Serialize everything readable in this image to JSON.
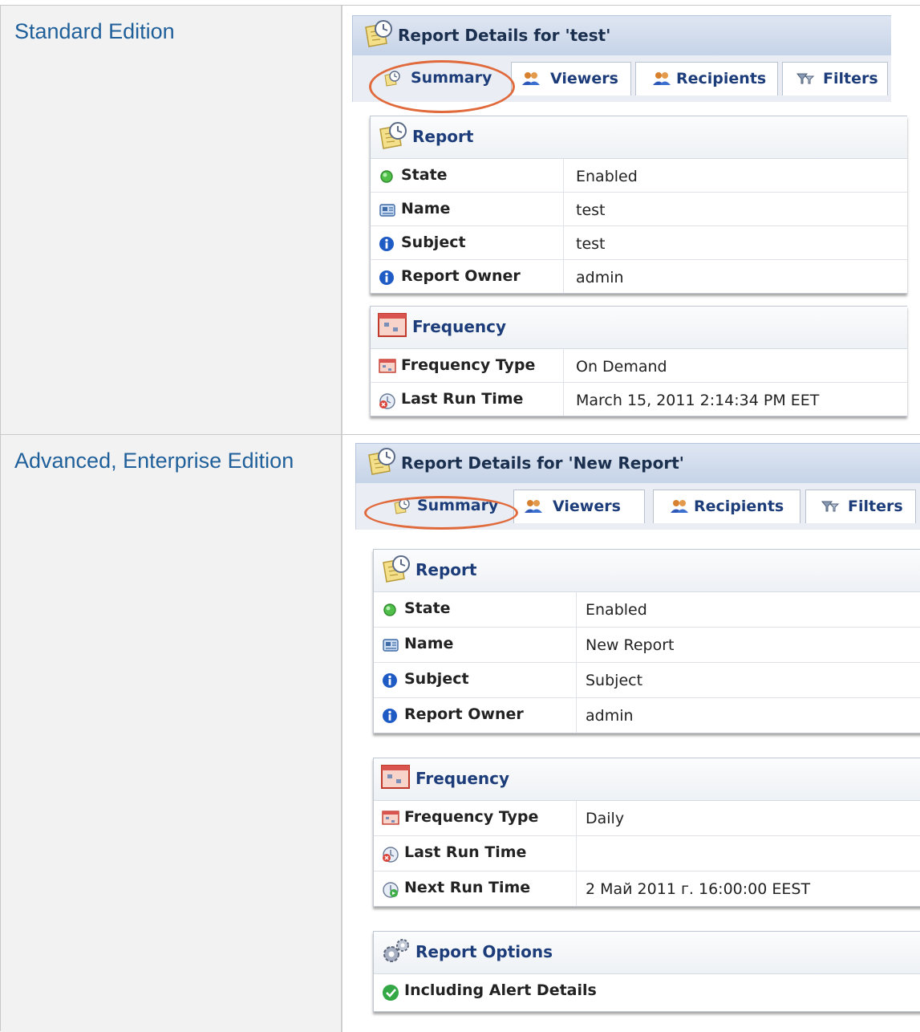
{
  "rows": [
    {
      "edition": "Standard Edition",
      "window_title": "Report Details for 'test'",
      "tabs": [
        "Summary",
        "Viewers",
        "Recipients",
        "Filters"
      ],
      "report_section": {
        "heading": "Report",
        "fields": [
          {
            "label": "State",
            "value": "Enabled",
            "icon": "green-dot-icon"
          },
          {
            "label": "Name",
            "value": "test",
            "icon": "name-card-icon"
          },
          {
            "label": "Subject",
            "value": "test",
            "icon": "info-icon"
          },
          {
            "label": "Report Owner",
            "value": "admin",
            "icon": "info-icon"
          }
        ]
      },
      "frequency_section": {
        "heading": "Frequency",
        "fields": [
          {
            "label": "Frequency Type",
            "value": "On Demand",
            "icon": "calendar-icon"
          },
          {
            "label": "Last Run Time",
            "value": "March 15, 2011 2:14:34 PM EET",
            "icon": "last-run-icon"
          }
        ]
      }
    },
    {
      "edition": "Advanced, Enterprise Edition",
      "window_title": "Report Details for 'New Report'",
      "tabs": [
        "Summary",
        "Viewers",
        "Recipients",
        "Filters"
      ],
      "report_section": {
        "heading": "Report",
        "fields": [
          {
            "label": "State",
            "value": "Enabled",
            "icon": "green-dot-icon"
          },
          {
            "label": "Name",
            "value": "New Report",
            "icon": "name-card-icon"
          },
          {
            "label": "Subject",
            "value": "Subject",
            "icon": "info-icon"
          },
          {
            "label": "Report Owner",
            "value": "admin",
            "icon": "info-icon"
          }
        ]
      },
      "frequency_section": {
        "heading": "Frequency",
        "fields": [
          {
            "label": "Frequency Type",
            "value": "Daily",
            "icon": "calendar-icon"
          },
          {
            "label": "Last Run Time",
            "value": "",
            "icon": "last-run-icon"
          },
          {
            "label": "Next Run Time",
            "value": "2 Май 2011 г. 16:00:00 EEST",
            "icon": "next-run-icon"
          }
        ]
      },
      "options_section": {
        "heading": "Report Options",
        "items": [
          {
            "label": "Including Alert Details",
            "icon": "green-check-icon"
          }
        ]
      }
    }
  ],
  "colors": {
    "edition_label": "#1f5f9a",
    "section_heading": "#1d3d7a",
    "highlight_oval": "#e06a3c",
    "titlebar": "#c5d3e8"
  }
}
